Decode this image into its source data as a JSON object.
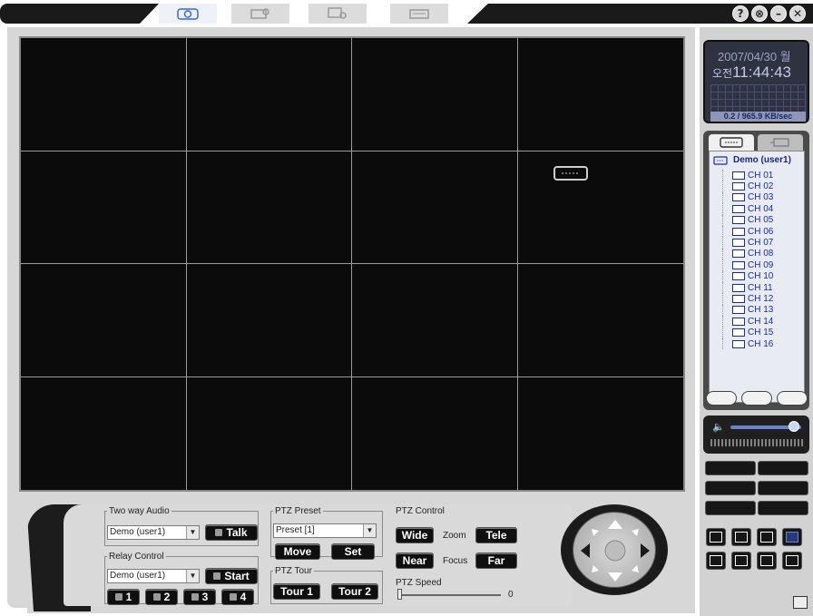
{
  "window_controls": [
    "?",
    "⊗",
    "–",
    "✕"
  ],
  "tabs": [
    {
      "name": "monitor",
      "active": true
    },
    {
      "name": "search",
      "active": false
    },
    {
      "name": "setup",
      "active": false
    },
    {
      "name": "keyboard",
      "active": false
    }
  ],
  "clock": {
    "date": "2007/04/30 월",
    "ampm": "오전",
    "time": "11:44:43",
    "rate": "0.2 / 965.9 KB/sec"
  },
  "tree": {
    "root": "Demo (user1)",
    "channels": [
      "CH 01",
      "CH 02",
      "CH 03",
      "CH 04",
      "CH 05",
      "CH 06",
      "CH 07",
      "CH 08",
      "CH 09",
      "CH 10",
      "CH 11",
      "CH 12",
      "CH 13",
      "CH 14",
      "CH 15",
      "CH 16"
    ]
  },
  "two_way_audio": {
    "legend": "Two way Audio",
    "selected": "Demo (user1)",
    "talk_label": "Talk"
  },
  "relay_control": {
    "legend": "Relay Control",
    "selected": "Demo (user1)",
    "start_label": "Start",
    "relays": [
      "1",
      "2",
      "3",
      "4"
    ]
  },
  "ptz_preset": {
    "legend": "PTZ Preset",
    "selected": "Preset [1]",
    "move_label": "Move",
    "set_label": "Set"
  },
  "ptz_tour": {
    "legend": "PTZ Tour",
    "tour1_label": "Tour 1",
    "tour2_label": "Tour 2"
  },
  "ptz_control": {
    "legend": "PTZ Control",
    "wide_label": "Wide",
    "zoom_label": "Zoom",
    "tele_label": "Tele",
    "near_label": "Near",
    "focus_label": "Focus",
    "far_label": "Far",
    "speed_label": "PTZ Speed",
    "speed_value": "0"
  },
  "volume_level": 0.9,
  "colors": {
    "accent": "#6b82c8",
    "tree_text": "#1b2aa0",
    "clock_bg": "#2f3240"
  }
}
